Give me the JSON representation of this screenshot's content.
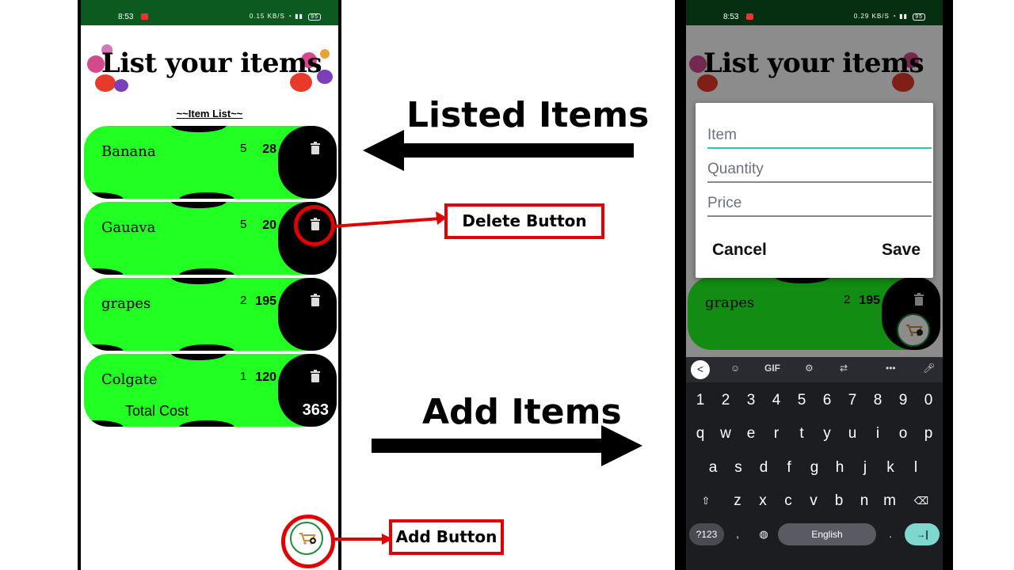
{
  "annotations": {
    "listed_items": "Listed Items",
    "add_items": "Add Items",
    "delete_button": "Delete Button",
    "add_button": "Add Button"
  },
  "status_bar": {
    "time": "8:53",
    "notification_badge": "■",
    "network_left": "0.15 KB/S",
    "network_right": "0.29 KB/S",
    "battery": "95"
  },
  "app": {
    "title": "List your items",
    "list_heading": "~~Item List~~",
    "items": [
      {
        "name": "Banana",
        "quantity": "5",
        "price": "28"
      },
      {
        "name": "Gauava",
        "quantity": "5",
        "price": "20"
      },
      {
        "name": "grapes",
        "quantity": "2",
        "price": "195"
      },
      {
        "name": "Colgate",
        "quantity": "1",
        "price": "120"
      }
    ],
    "total_label": "Total Cost",
    "total_value": "363"
  },
  "dialog": {
    "item_placeholder": "Item",
    "quantity_placeholder": "Quantity",
    "price_placeholder": "Price",
    "cancel": "Cancel",
    "save": "Save"
  },
  "keyboard": {
    "toolbar": {
      "back": "<",
      "gif": "GIF"
    },
    "row1": [
      "1",
      "2",
      "3",
      "4",
      "5",
      "6",
      "7",
      "8",
      "9",
      "0"
    ],
    "row2": [
      "q",
      "w",
      "e",
      "r",
      "t",
      "y",
      "u",
      "i",
      "o",
      "p"
    ],
    "row3": [
      "a",
      "s",
      "d",
      "f",
      "g",
      "h",
      "j",
      "k",
      "l"
    ],
    "row4": [
      "z",
      "x",
      "c",
      "v",
      "b",
      "n",
      "m"
    ],
    "sym_key": "?123",
    "comma_key": ",",
    "space_label": "English",
    "period_key": ".",
    "enter_key": "→|"
  },
  "colors": {
    "status_bar": "#0d5a20",
    "card_green": "#22ff22",
    "callout_red": "#e00000",
    "accent_teal": "#2fc4b2"
  }
}
